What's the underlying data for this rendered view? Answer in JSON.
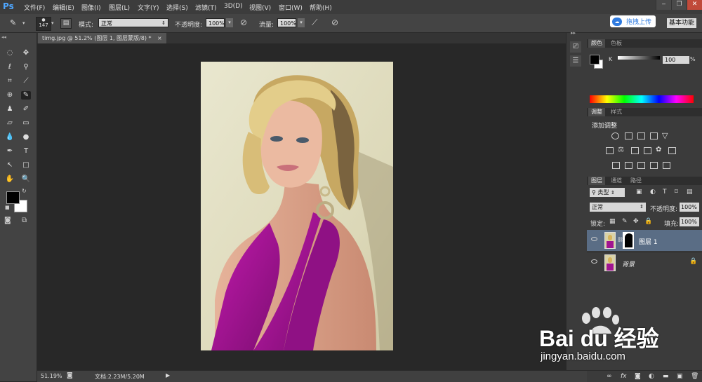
{
  "menubar": {
    "logo": "Ps",
    "items": [
      "文件(F)",
      "编辑(E)",
      "图像(I)",
      "图层(L)",
      "文字(Y)",
      "选择(S)",
      "滤镜(T)",
      "3D(D)",
      "视图(V)",
      "窗口(W)",
      "帮助(H)"
    ]
  },
  "options": {
    "brush_size": "147",
    "mode_label": "模式:",
    "mode_value": "正常",
    "opacity_label": "不透明度:",
    "opacity_value": "100%",
    "flow_label": "流量:",
    "flow_value": "100%"
  },
  "upload_label": "拖拽上传",
  "workspace_label": "基本功能",
  "document": {
    "tab_title": "timg.jpg @ 51.2% (图层 1, 图层蒙版/8) *",
    "close": "×"
  },
  "status": {
    "zoom": "51.19%",
    "doc_info": "文档:2.23M/5.20M"
  },
  "color_panel": {
    "tabs": [
      "颜色",
      "色板"
    ],
    "channel_label": "K",
    "channel_value": "100"
  },
  "adjust_panel": {
    "tabs": [
      "调整",
      "样式"
    ],
    "title": "添加调整"
  },
  "layers_panel": {
    "tabs": [
      "图层",
      "通道",
      "路径"
    ],
    "filter_label": "类型",
    "blend_mode": "正常",
    "opacity_label": "不透明度:",
    "opacity_value": "100%",
    "lock_label": "锁定:",
    "fill_label": "填充:",
    "fill_value": "100%",
    "layers": [
      {
        "name": "图层 1",
        "selected": true
      },
      {
        "name": "背景",
        "selected": false
      }
    ]
  },
  "watermark": {
    "brand": "Bai du 经验",
    "url": "jingyan.baidu.com"
  },
  "colors": {
    "accent": "#4ea6ff",
    "dress": "#a01491",
    "selected_layer": "#5a6d85"
  }
}
